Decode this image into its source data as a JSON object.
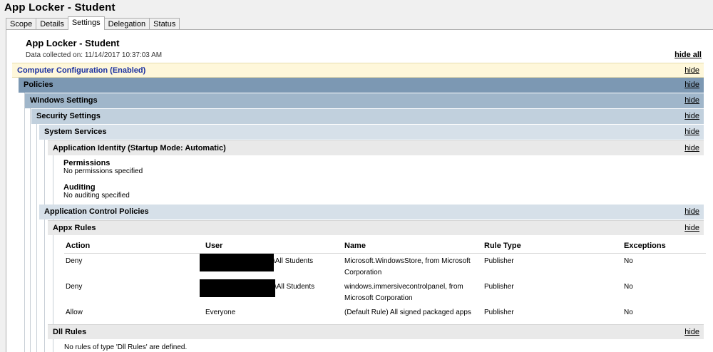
{
  "window": {
    "title": "App Locker - Student"
  },
  "tabs": [
    "Scope",
    "Details",
    "Settings",
    "Delegation",
    "Status"
  ],
  "report": {
    "title": "App Locker - Student",
    "collected": "Data collected on: 11/14/2017 10:37:03 AM",
    "hide_all": "hide all",
    "hide": "hide"
  },
  "sections": {
    "computer_config": "Computer Configuration (Enabled)",
    "policies": "Policies",
    "windows_settings": "Windows Settings",
    "security_settings": "Security Settings",
    "system_services": "System Services",
    "app_identity": "Application Identity (Startup Mode: Automatic)",
    "permissions": {
      "heading": "Permissions",
      "text": "No permissions specified"
    },
    "auditing": {
      "heading": "Auditing",
      "text": "No auditing specified"
    },
    "app_control": "Application Control Policies",
    "appx_rules": "Appx Rules",
    "dll_rules": "Dll Rules",
    "dll_text": "No rules of type 'Dll Rules' are defined."
  },
  "table": {
    "headers": [
      "Action",
      "User",
      "Name",
      "Rule Type",
      "Exceptions"
    ],
    "rows": [
      {
        "action": "Deny",
        "user": "\\All Students",
        "name1": "Microsoft.WindowsStore, from Microsoft",
        "name2": "Corporation",
        "rule_type": "Publisher",
        "exceptions": "No"
      },
      {
        "action": "Deny",
        "user": "\\All Students",
        "name1": "windows.immersivecontrolpanel, from",
        "name2": "Microsoft Corporation",
        "rule_type": "Publisher",
        "exceptions": "No"
      },
      {
        "action": "Allow",
        "user": "Everyone",
        "name1": "(Default Rule) All signed packaged apps",
        "name2": "",
        "rule_type": "Publisher",
        "exceptions": "No"
      }
    ]
  }
}
